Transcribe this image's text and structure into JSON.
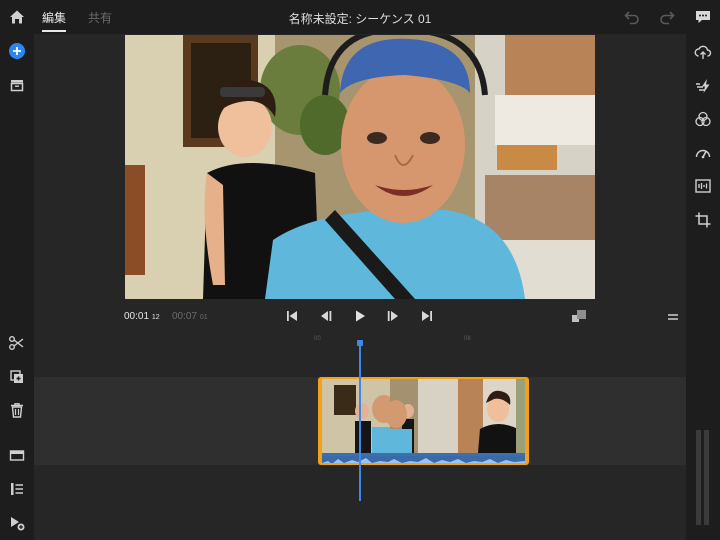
{
  "header": {
    "tab_edit": "編集",
    "tab_share": "共有",
    "title": "名称未設定: シーケンス 01"
  },
  "transport": {
    "current_time": "00:01",
    "current_frames": "12",
    "total_time": "00:07",
    "total_frames": "01"
  },
  "ruler": {
    "mark_1": "00",
    "mark_2": "08"
  },
  "colors": {
    "accent_blue": "#2d86f0",
    "clip_border": "#f2a11a",
    "playhead": "#3f87e8",
    "background": "#1d1d1d",
    "panel": "#262626"
  },
  "icons": {
    "left": [
      "home-icon",
      "add-media-icon",
      "projects-icon",
      "split-icon",
      "duplicate-icon",
      "delete-icon",
      "track-icon",
      "list-icon",
      "add-clip-icon"
    ],
    "right": [
      "comment-icon",
      "upload-icon",
      "auto-adjust-icon",
      "color-icon",
      "speed-icon",
      "audio-icon",
      "crop-icon"
    ]
  }
}
